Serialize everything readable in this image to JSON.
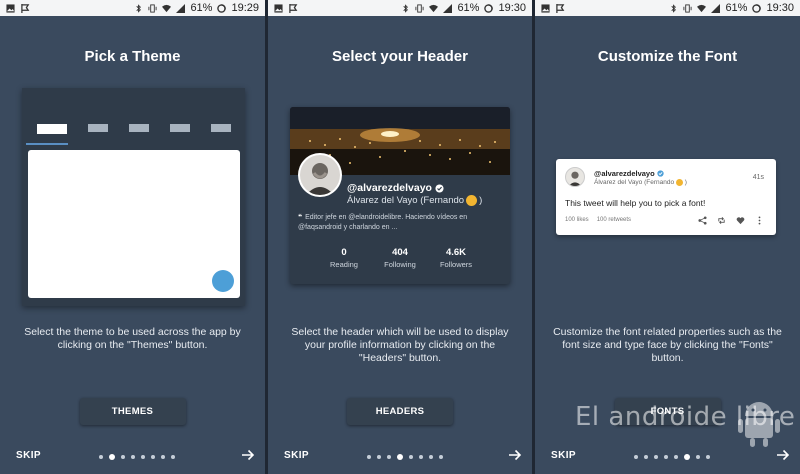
{
  "status_bar": [
    {
      "battery": "61%",
      "time": "19:29"
    },
    {
      "battery": "61%",
      "time": "19:30"
    },
    {
      "battery": "61%",
      "time": "19:30"
    }
  ],
  "panels": [
    {
      "title": "Pick a Theme",
      "description": "Select the theme to be used across the app by clicking on the \"Themes\" button.",
      "button": "THEMES"
    },
    {
      "title": "Select your Header",
      "description": "Select the header which will be used to display your profile information by clicking on the \"Headers\" button.",
      "button": "HEADERS"
    },
    {
      "title": "Customize the Font",
      "description": "Customize the font related properties such as the font size and type face by clicking the \"Fonts\" button.",
      "button": "FONTS"
    }
  ],
  "profile": {
    "handle": "@alvarezdelvayo",
    "name": "Álvarez del Vayo (Fernando",
    "bio": "Editor jefe en @elandroidelibre. Haciendo vídeos en @faqsandroid y charlando en ...",
    "stats": [
      {
        "value": "0",
        "label": "Reading"
      },
      {
        "value": "404",
        "label": "Following"
      },
      {
        "value": "4.6K",
        "label": "Followers"
      }
    ]
  },
  "tweet": {
    "handle": "@alvarezdelvayo",
    "name": "Álvarez del Vayo (Fernando",
    "time": "41s",
    "text": "This tweet will help you to pick a font!",
    "likes": "100 likes",
    "retweets": "100 retweets"
  },
  "nav": {
    "skip": "SKIP",
    "dot_count": 8,
    "active_dots": [
      1,
      3,
      5
    ]
  },
  "watermark": "El androide libre",
  "colors": {
    "panel_bg": "#3a4a5e",
    "card_bg": "#2f3b49",
    "accent": "#4d9fd7",
    "status_bar": "#f4f5f6"
  }
}
